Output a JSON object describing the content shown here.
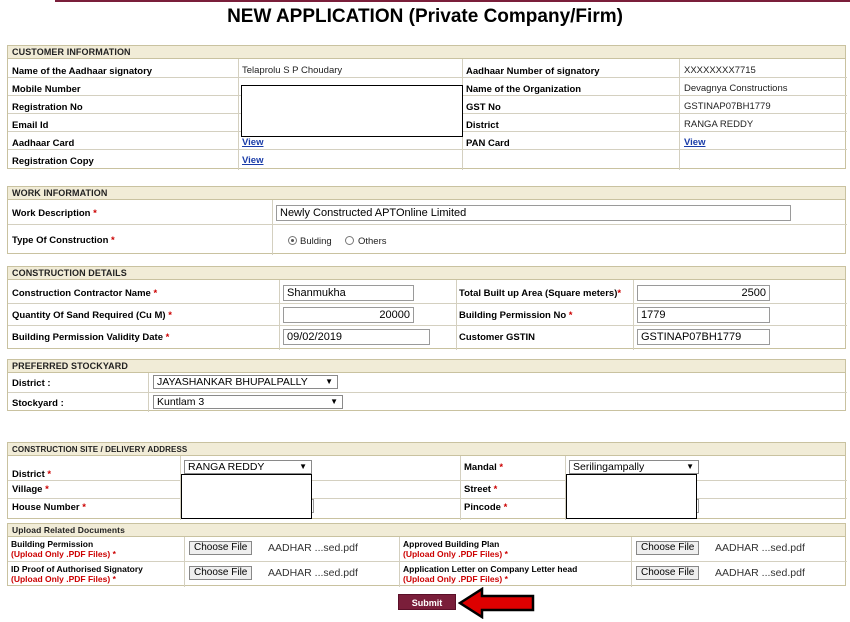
{
  "page_title": "NEW APPLICATION (Private Company/Firm)",
  "customer": {
    "heading": "CUSTOMER INFORMATION",
    "aadhaar_signatory_label": "Name of the Aadhaar signatory",
    "aadhaar_signatory_value": "Telaprolu S P Choudary",
    "aadhaar_number_label": "Aadhaar Number of signatory",
    "aadhaar_number_value": "XXXXXXXX7715",
    "mobile_label": "Mobile Number",
    "org_label": "Name of the Organization",
    "org_value": "Devagnya Constructions",
    "reg_no_label": "Registration No",
    "gst_label": "GST No",
    "gst_value": "GSTINAP07BH1779",
    "email_label": "Email Id",
    "district_label": "District",
    "district_value": "RANGA REDDY",
    "aadhaar_card_label": "Aadhaar Card",
    "pan_card_label": "PAN Card",
    "reg_copy_label": "Registration Copy",
    "view_link": "View"
  },
  "work": {
    "heading": "WORK INFORMATION",
    "desc_label": "Work Description",
    "desc_value": "Newly Constructed APTOnline Limited",
    "type_label": "Type Of Construction",
    "type_options": [
      "Bulding",
      "Others"
    ],
    "type_selected": "Bulding"
  },
  "construction": {
    "heading": "CONSTRUCTION DETAILS",
    "contractor_label": "Construction Contractor Name",
    "contractor_value": "Shanmukha",
    "builtup_label": "Total Built up Area (Square meters)",
    "builtup_value": "2500",
    "sand_qty_label": "Quantity Of Sand Required (Cu M)",
    "sand_qty_value": "20000",
    "permission_no_label": "Building Permission No",
    "permission_no_value": "1779",
    "validity_label": "Building Permission Validity Date",
    "validity_value": "09/02/2019",
    "cust_gstin_label": "Customer GSTIN",
    "cust_gstin_value": "GSTINAP07BH1779"
  },
  "stockyard": {
    "heading": "PREFERRED STOCKYARD",
    "district_label": "District :",
    "district_value": "JAYASHANKAR BHUPALPALLY",
    "stockyard_label": "Stockyard :",
    "stockyard_value": "Kuntlam 3"
  },
  "site": {
    "heading": "CONSTRUCTION SITE / DELIVERY ADDRESS",
    "district_label": "District",
    "district_value": "RANGA REDDY",
    "mandal_label": "Mandal",
    "mandal_value": "Serilingampally",
    "village_label": "Village",
    "street_label": "Street",
    "house_label": "House Number",
    "pincode_label": "Pincode"
  },
  "uploads": {
    "heading": "Upload Related Documents",
    "note": "(Upload Only .PDF Files)",
    "choose_label": "Choose File",
    "items": [
      {
        "label": "Building Permission",
        "file": "AADHAR ...sed.pdf"
      },
      {
        "label": "Approved Building Plan",
        "file": "AADHAR ...sed.pdf"
      },
      {
        "label": "ID Proof of Authorised Signatory",
        "file": "AADHAR ...sed.pdf"
      },
      {
        "label": "Application Letter on Company Letter head",
        "file": "AADHAR ...sed.pdf"
      }
    ]
  },
  "submit_label": "Submit",
  "colors": {
    "accent": "#7a1e3a",
    "header_bg": "#f1ecd7",
    "required": "#cc0000",
    "link": "#1a3ca8",
    "arrow": "#dd0000"
  }
}
